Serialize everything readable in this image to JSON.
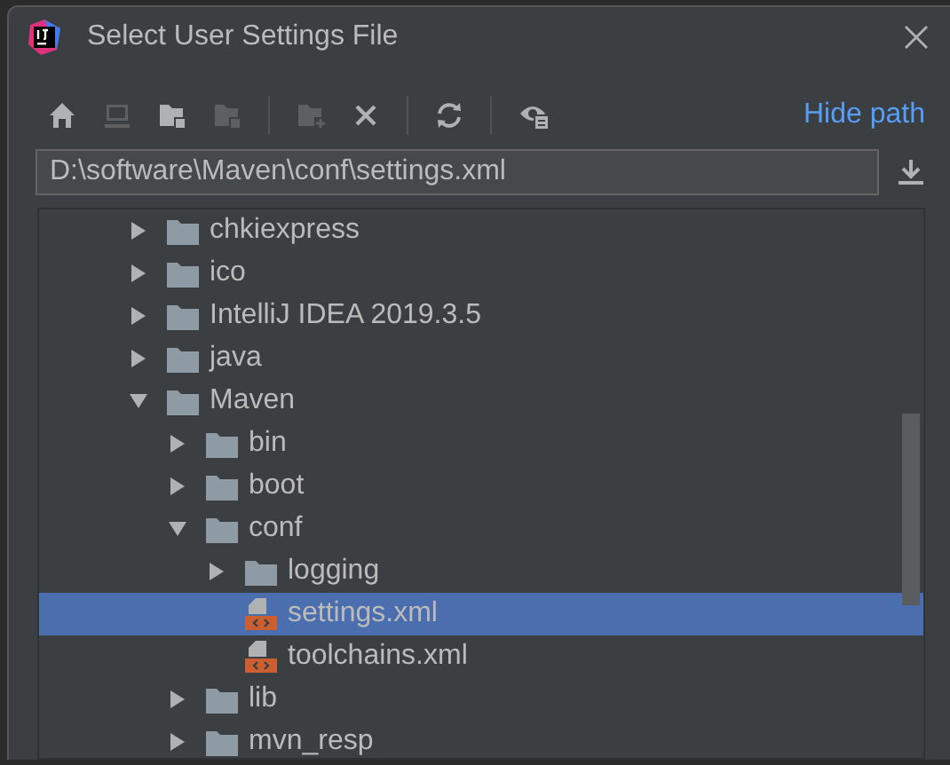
{
  "window": {
    "title": "Select User Settings File"
  },
  "toolbar": [
    {
      "kind": "home",
      "disabled": false
    },
    {
      "kind": "computer",
      "disabled": true
    },
    {
      "kind": "folder-square",
      "disabled": false
    },
    {
      "kind": "folder-square",
      "disabled": true
    },
    {
      "kind": "separator"
    },
    {
      "kind": "new-folder",
      "disabled": true
    },
    {
      "kind": "delete",
      "disabled": false
    },
    {
      "kind": "separator"
    },
    {
      "kind": "refresh",
      "disabled": false
    },
    {
      "kind": "separator"
    },
    {
      "kind": "eye",
      "disabled": false
    }
  ],
  "hide_path_link": "Hide path",
  "path_field": {
    "value": "D:\\software\\Maven\\conf\\settings.xml"
  },
  "tree": [
    {
      "name": "chkiexpress",
      "kind": "folder",
      "expanded": false,
      "selected": false
    },
    {
      "name": "ico",
      "kind": "folder",
      "expanded": false,
      "selected": false
    },
    {
      "name": "IntelliJ IDEA 2019.3.5",
      "kind": "folder",
      "expanded": false,
      "selected": false
    },
    {
      "name": "java",
      "kind": "folder",
      "expanded": false,
      "selected": false
    },
    {
      "name": "Maven",
      "kind": "folder",
      "expanded": true,
      "selected": false,
      "children": [
        {
          "name": "bin",
          "kind": "folder",
          "expanded": false,
          "selected": false
        },
        {
          "name": "boot",
          "kind": "folder",
          "expanded": false,
          "selected": false
        },
        {
          "name": "conf",
          "kind": "folder",
          "expanded": true,
          "selected": false,
          "children": [
            {
              "name": "logging",
              "kind": "folder",
              "expanded": false,
              "selected": false
            },
            {
              "name": "settings.xml",
              "kind": "xml",
              "selected": true
            },
            {
              "name": "toolchains.xml",
              "kind": "xml",
              "selected": false
            }
          ]
        },
        {
          "name": "lib",
          "kind": "folder",
          "expanded": false,
          "selected": false
        },
        {
          "name": "mvn_resp",
          "kind": "folder",
          "expanded": false,
          "selected": false
        }
      ]
    }
  ]
}
